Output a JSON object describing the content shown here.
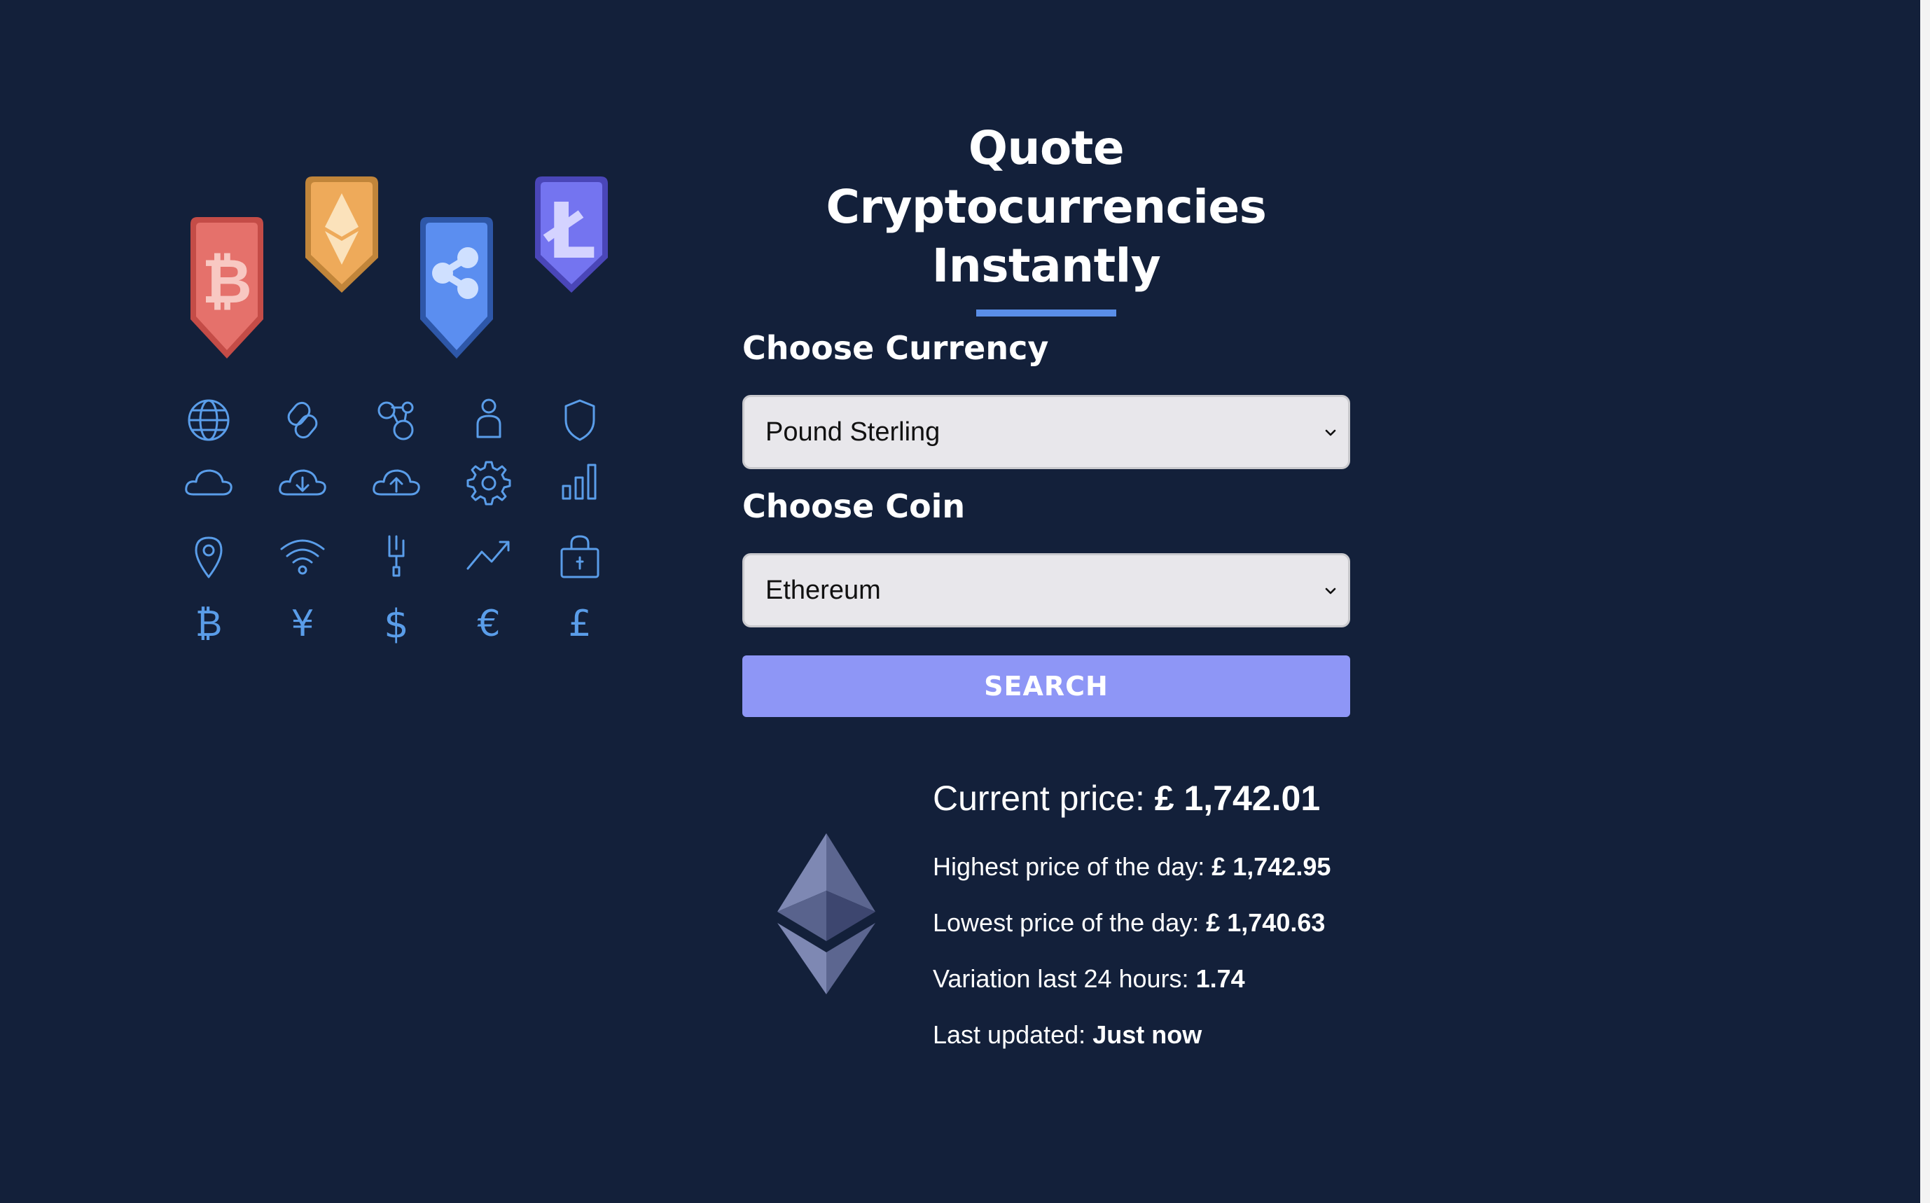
{
  "page": {
    "title": "Quote Cryptocurrencies Instantly",
    "accent_color": "#5a8ee8",
    "background_color": "#13203a",
    "button_color": "#8e96f6"
  },
  "illustration": {
    "badges": [
      {
        "name": "bitcoin-badge",
        "icon": "bitcoin-icon",
        "color": "#e5716b"
      },
      {
        "name": "ethereum-badge",
        "icon": "ethereum-icon",
        "color": "#eeaa5a"
      },
      {
        "name": "ripple-badge",
        "icon": "ripple-icon",
        "color": "#5b8ef0"
      },
      {
        "name": "litecoin-badge",
        "icon": "litecoin-icon",
        "color": "#7474f0"
      }
    ],
    "icons": [
      "globe-icon",
      "link-icon",
      "network-icon",
      "user-icon",
      "shield-icon",
      "cloud-icon",
      "cloud-download-icon",
      "cloud-upload-icon",
      "gear-icon",
      "bar-chart-icon",
      "location-pin-icon",
      "wifi-icon",
      "plug-icon",
      "trend-up-icon",
      "lock-icon",
      "bitcoin-sign-icon",
      "yen-sign-icon",
      "dollar-sign-icon",
      "euro-sign-icon",
      "pound-sign-icon"
    ]
  },
  "form": {
    "currency_label": "Choose Currency",
    "currency_value": "Pound Sterling",
    "coin_label": "Choose Coin",
    "coin_value": "Ethereum",
    "search_label": "SEARCH"
  },
  "result": {
    "current_price_label": "Current price:",
    "current_price_value": "£ 1,742.01",
    "high_label": "Highest price of the day:",
    "high_value": "£ 1,742.95",
    "low_label": "Lowest price of the day:",
    "low_value": "£ 1,740.63",
    "variation_label": "Variation last 24 hours:",
    "variation_value": "1.74",
    "updated_label": "Last updated:",
    "updated_value": "Just now"
  }
}
